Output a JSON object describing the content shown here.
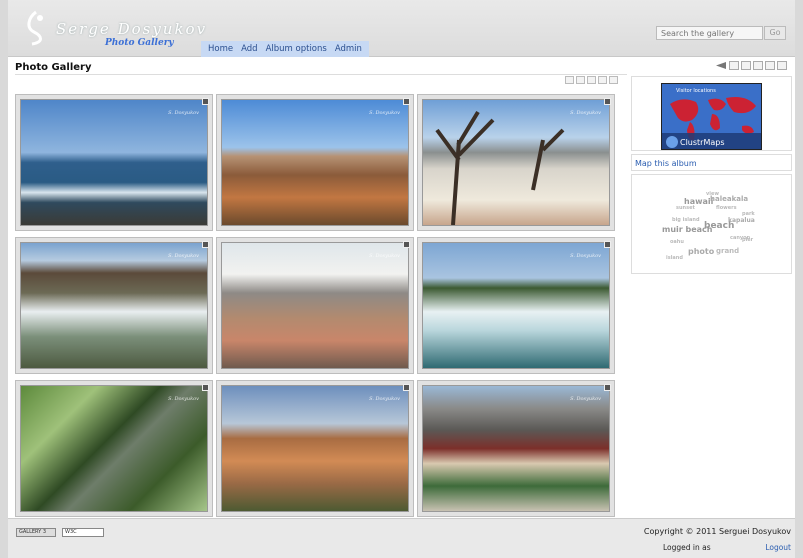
{
  "header": {
    "logo_name": "Serge Dosyukov",
    "logo_sub": "Photo Gallery",
    "nav": [
      "Home",
      "Add",
      "Album options",
      "Admin"
    ],
    "search_placeholder": "Search the gallery",
    "search_go": "Go"
  },
  "page": {
    "title": "Photo Gallery"
  },
  "sidebar": {
    "clustr_title": "Visitor locations",
    "clustr_brand": "ClustrMaps",
    "map_link": "Map this album",
    "tags": [
      "hawaii",
      "haleakala",
      "muir beach",
      "beach",
      "kapalua",
      "photo",
      "pier",
      "grand",
      "view",
      "oahu",
      "canyon",
      "flowers",
      "sunset",
      "island",
      "park",
      "big island"
    ]
  },
  "footer": {
    "badge1": "GALLERY 3",
    "badge2": "W3C",
    "copyright": "Copyright © 2011 Serguei Dosyukov",
    "logged_in": "Logged in as",
    "logout": "Logout"
  }
}
